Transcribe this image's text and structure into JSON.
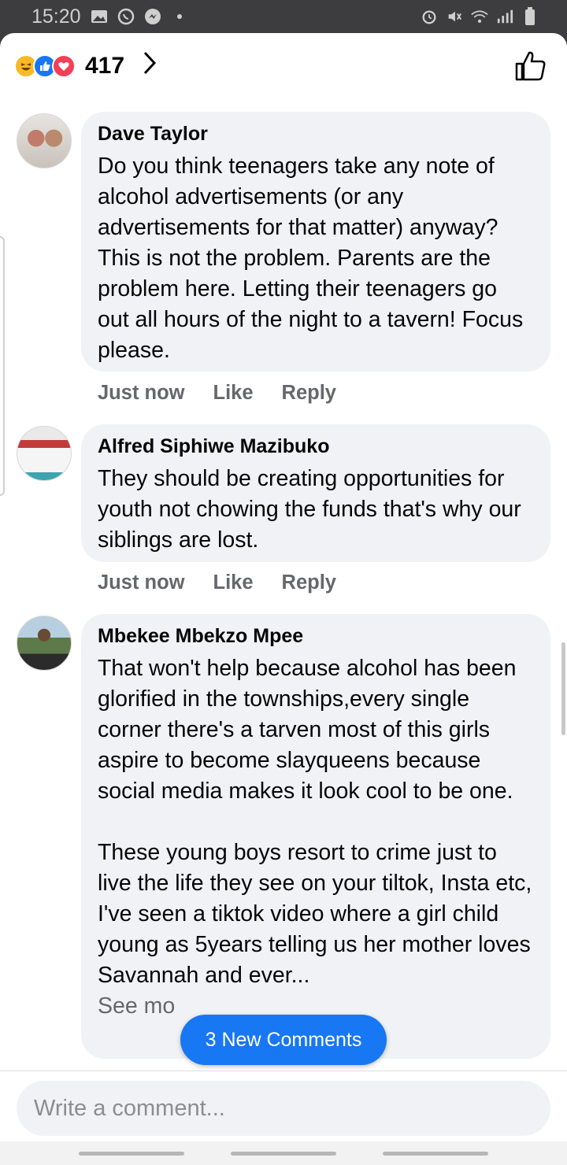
{
  "status_bar": {
    "time": "15:20",
    "left_icons": [
      "image-icon",
      "whatsapp-icon",
      "messenger-icon",
      "dot-icon"
    ],
    "right_icons": [
      "alarm-icon",
      "mute-icon",
      "wifi-icon",
      "signal-icon",
      "battery-icon"
    ]
  },
  "header": {
    "reactions": [
      "haha",
      "like",
      "love"
    ],
    "reaction_count": "417",
    "chevron": ">"
  },
  "comments": [
    {
      "author": "Dave Taylor",
      "text": "Do you think teenagers take any note of alcohol advertisements (or any advertisements for that matter) anyway? This is not the problem. Parents are the problem here. Letting their teenagers go out all hours of the night to a tavern! Focus please.",
      "time": "Just now",
      "like_label": "Like",
      "reply_label": "Reply"
    },
    {
      "author": "Alfred Siphiwe Mazibuko",
      "text": "They should be creating opportunities for youth not chowing the funds that's why our siblings are lost.",
      "time": "Just now",
      "like_label": "Like",
      "reply_label": "Reply"
    },
    {
      "author": "Mbekee Mbekzo Mpee",
      "text": "That won't help because alcohol has been glorified in the townships,every single corner there's a tarven most of this girls aspire to become slayqueens because social media makes it look cool to be one.\n\nThese young boys resort to crime just to live the life they see on your tiltok, Insta etc, I've seen a tiktok video where a girl child young as 5years telling us her mother loves Savannah and ever...",
      "see_more": "See mo"
    }
  ],
  "new_comments_label": "3 New Comments",
  "composer": {
    "placeholder": "Write a comment..."
  }
}
